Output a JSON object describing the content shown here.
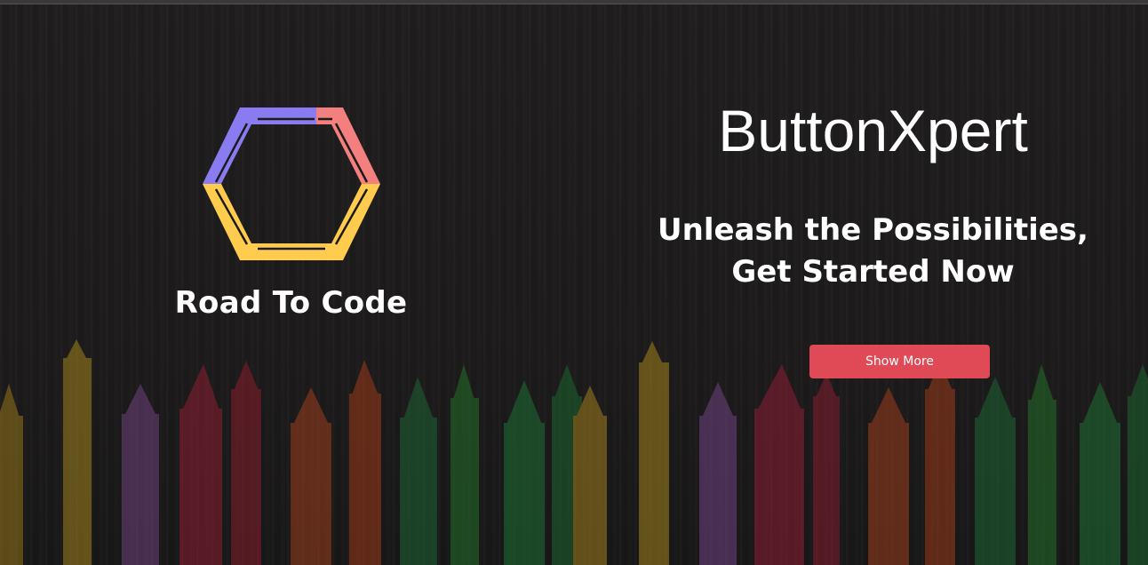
{
  "brand": {
    "name": "Road To Code",
    "logo_icon": "hexagon-logo-icon",
    "logo_colors": {
      "left_top": "#8a7cf0",
      "right_top": "#f47f7f",
      "bottom": "#ffcc4d"
    }
  },
  "hero": {
    "title": "ButtonXpert",
    "subtitle_line1": "Unleash the Possibilities,",
    "subtitle_line2": "Get Started Now"
  },
  "cta": {
    "label": "Show More",
    "color": "#e04a57"
  },
  "background": {
    "description_icon": "crayons-background",
    "base_color": "#1c1b1b"
  }
}
